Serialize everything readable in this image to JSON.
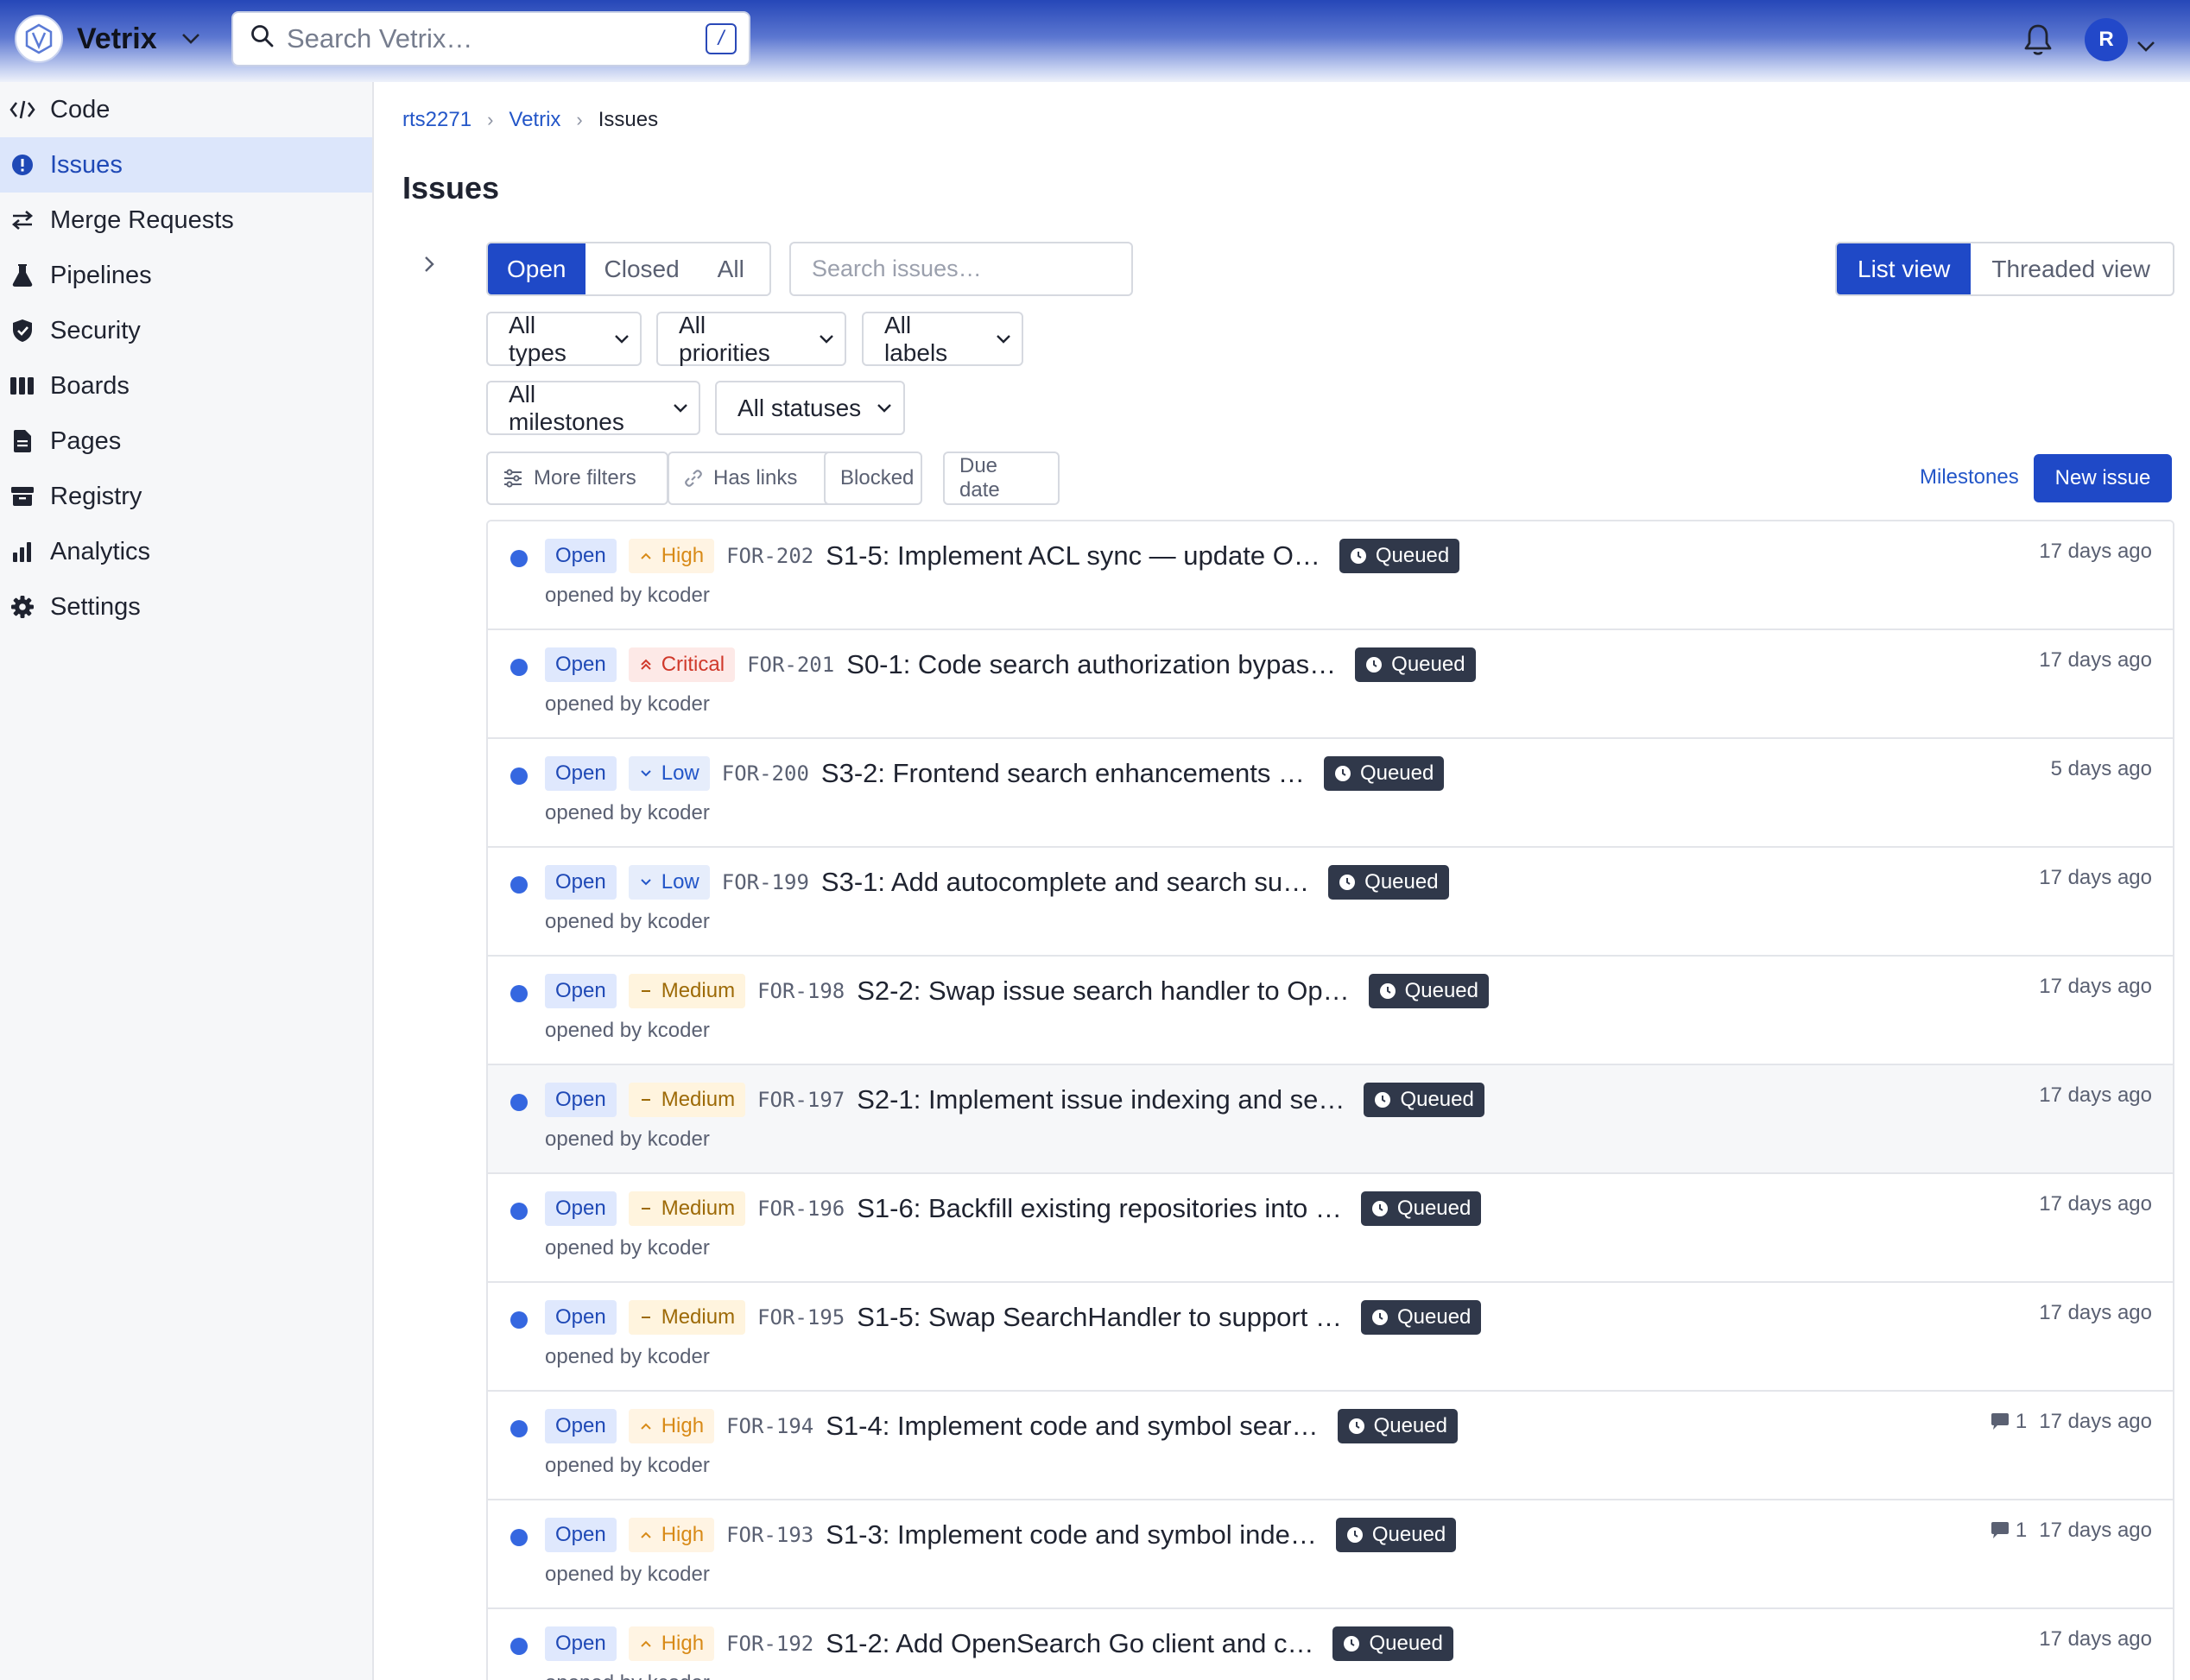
{
  "app": {
    "name": "Vetrix",
    "search_placeholder": "Search Vetrix…",
    "search_shortcut": "/",
    "user_initial": "R"
  },
  "sidebar": {
    "items": [
      {
        "label": "Code",
        "icon": "code-icon"
      },
      {
        "label": "Issues",
        "icon": "issue-icon",
        "active": true
      },
      {
        "label": "Merge Requests",
        "icon": "merge-icon"
      },
      {
        "label": "Pipelines",
        "icon": "flask-icon"
      },
      {
        "label": "Security",
        "icon": "shield-icon"
      },
      {
        "label": "Boards",
        "icon": "board-icon"
      },
      {
        "label": "Pages",
        "icon": "page-icon"
      },
      {
        "label": "Registry",
        "icon": "registry-icon"
      },
      {
        "label": "Analytics",
        "icon": "analytics-icon"
      },
      {
        "label": "Settings",
        "icon": "gear-icon"
      }
    ]
  },
  "breadcrumb": [
    "rts2271",
    "Vetrix",
    "Issues"
  ],
  "page_title": "Issues",
  "state_tabs": [
    "Open",
    "Closed",
    "All"
  ],
  "issue_search_placeholder": "Search issues…",
  "views": [
    "List view",
    "Threaded view"
  ],
  "filters": {
    "types": "All types",
    "priorities": "All priorities",
    "labels": "All labels",
    "milestones": "All milestones",
    "statuses": "All statuses"
  },
  "chips": [
    "More filters",
    "Has links",
    "Blocked",
    "Due date"
  ],
  "actions": {
    "milestones": "Milestones",
    "new_issue": "New issue"
  },
  "colors": {
    "accent": "#1f49c7",
    "open_dot": "#3567e0",
    "status_bg": "#30384a"
  },
  "issues": [
    {
      "state": "Open",
      "priority": "High",
      "key": "FOR-202",
      "title": "S1-5: Implement ACL sync — update O…",
      "status": "Queued",
      "meta": "opened by kcoder",
      "age": "17 days ago",
      "comments": ""
    },
    {
      "state": "Open",
      "priority": "Critical",
      "key": "FOR-201",
      "title": "S0-1: Code search authorization bypas…",
      "status": "Queued",
      "meta": "opened by kcoder",
      "age": "17 days ago",
      "comments": ""
    },
    {
      "state": "Open",
      "priority": "Low",
      "key": "FOR-200",
      "title": "S3-2: Frontend search enhancements …",
      "status": "Queued",
      "meta": "opened by kcoder",
      "age": "5 days ago",
      "comments": ""
    },
    {
      "state": "Open",
      "priority": "Low",
      "key": "FOR-199",
      "title": "S3-1: Add autocomplete and search su…",
      "status": "Queued",
      "meta": "opened by kcoder",
      "age": "17 days ago",
      "comments": ""
    },
    {
      "state": "Open",
      "priority": "Medium",
      "key": "FOR-198",
      "title": "S2-2: Swap issue search handler to Op…",
      "status": "Queued",
      "meta": "opened by kcoder",
      "age": "17 days ago",
      "comments": ""
    },
    {
      "state": "Open",
      "priority": "Medium",
      "key": "FOR-197",
      "title": "S2-1: Implement issue indexing and se…",
      "status": "Queued",
      "meta": "opened by kcoder",
      "age": "17 days ago",
      "comments": "",
      "hover": true
    },
    {
      "state": "Open",
      "priority": "Medium",
      "key": "FOR-196",
      "title": "S1-6: Backfill existing repositories into …",
      "status": "Queued",
      "meta": "opened by kcoder",
      "age": "17 days ago",
      "comments": ""
    },
    {
      "state": "Open",
      "priority": "Medium",
      "key": "FOR-195",
      "title": "S1-5: Swap SearchHandler to support …",
      "status": "Queued",
      "meta": "opened by kcoder",
      "age": "17 days ago",
      "comments": ""
    },
    {
      "state": "Open",
      "priority": "High",
      "key": "FOR-194",
      "title": "S1-4: Implement code and symbol sear…",
      "status": "Queued",
      "meta": "opened by kcoder",
      "age": "17 days ago",
      "comments": "1"
    },
    {
      "state": "Open",
      "priority": "High",
      "key": "FOR-193",
      "title": "S1-3: Implement code and symbol inde…",
      "status": "Queued",
      "meta": "opened by kcoder",
      "age": "17 days ago",
      "comments": "1"
    },
    {
      "state": "Open",
      "priority": "High",
      "key": "FOR-192",
      "title": "S1-2: Add OpenSearch Go client and c…",
      "status": "Queued",
      "meta": "opened by kcoder",
      "age": "17 days ago",
      "comments": ""
    }
  ]
}
